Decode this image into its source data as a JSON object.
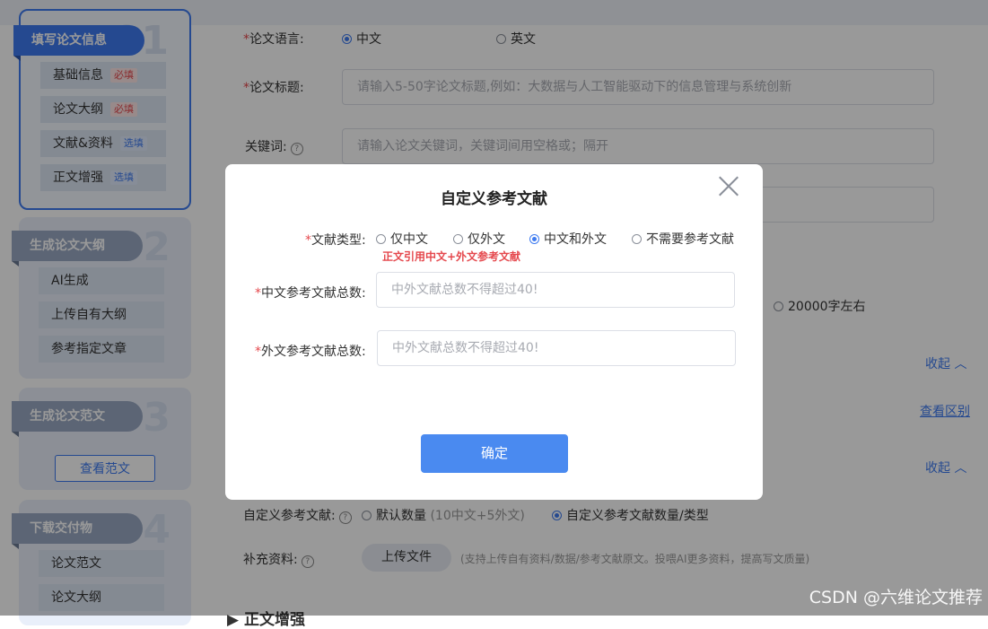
{
  "sidebar": {
    "step1": {
      "num": "01",
      "title": "填写论文信息",
      "items": [
        {
          "label": "基础信息",
          "badge": "必填"
        },
        {
          "label": "论文大纲",
          "badge": "必填"
        },
        {
          "label": "文献&资料",
          "badge": "选填"
        },
        {
          "label": "正文增强",
          "badge": "选填"
        }
      ]
    },
    "step2": {
      "num": "02",
      "title": "生成论文大纲",
      "items": [
        {
          "label": "AI生成"
        },
        {
          "label": "上传自有大纲"
        },
        {
          "label": "参考指定文章"
        }
      ]
    },
    "step3": {
      "num": "03",
      "title": "生成论文范文",
      "button": "查看范文"
    },
    "step4": {
      "num": "04",
      "title": "下载交付物",
      "items": [
        {
          "label": "论文范文"
        },
        {
          "label": "论文大纲"
        }
      ]
    }
  },
  "form": {
    "language_label": "论文语言:",
    "language_options": [
      "中文",
      "英文"
    ],
    "title_label": "论文标题:",
    "title_placeholder": "请输入5-50字论文标题,例如：大数据与人工智能驱动下的信息管理与系统创新",
    "keywords_label": "关键词:",
    "keywords_placeholder": "请输入论文关键词，关键词间用空格或；隔开",
    "word_option": "20000字左右",
    "collapse_1": "收起",
    "view_difference": "查看区别",
    "collapse_2": "收起",
    "ref_label": "自定义参考文献:",
    "ref_default": "默认数量",
    "ref_default_note": "(10中文+5外文)",
    "ref_custom": "自定义参考文献数量/类型",
    "supplement_label": "补充资料:",
    "upload_button": "上传文件",
    "upload_note": "(支持上传自有资料/数据/参考文献原文。投喂AI更多资料，提高写文质量)",
    "section_partial": "正文增强"
  },
  "modal": {
    "title": "自定义参考文献",
    "type_label": "文献类型:",
    "type_options": [
      "仅中文",
      "仅外文",
      "中文和外文",
      "不需要参考文献"
    ],
    "type_note": "正文引用中文+外文参考文献",
    "cn_label": "中文参考文献总数:",
    "cn_placeholder": "中外文献总数不得超过40!",
    "en_label": "外文参考文献总数:",
    "en_placeholder": "中外文献总数不得超过40!",
    "confirm": "确定"
  },
  "watermark": "CSDN @六维论文推荐",
  "colors": {
    "accent": "#3e7bf0",
    "required": "#e5484d",
    "confirm": "#4a8af0"
  }
}
